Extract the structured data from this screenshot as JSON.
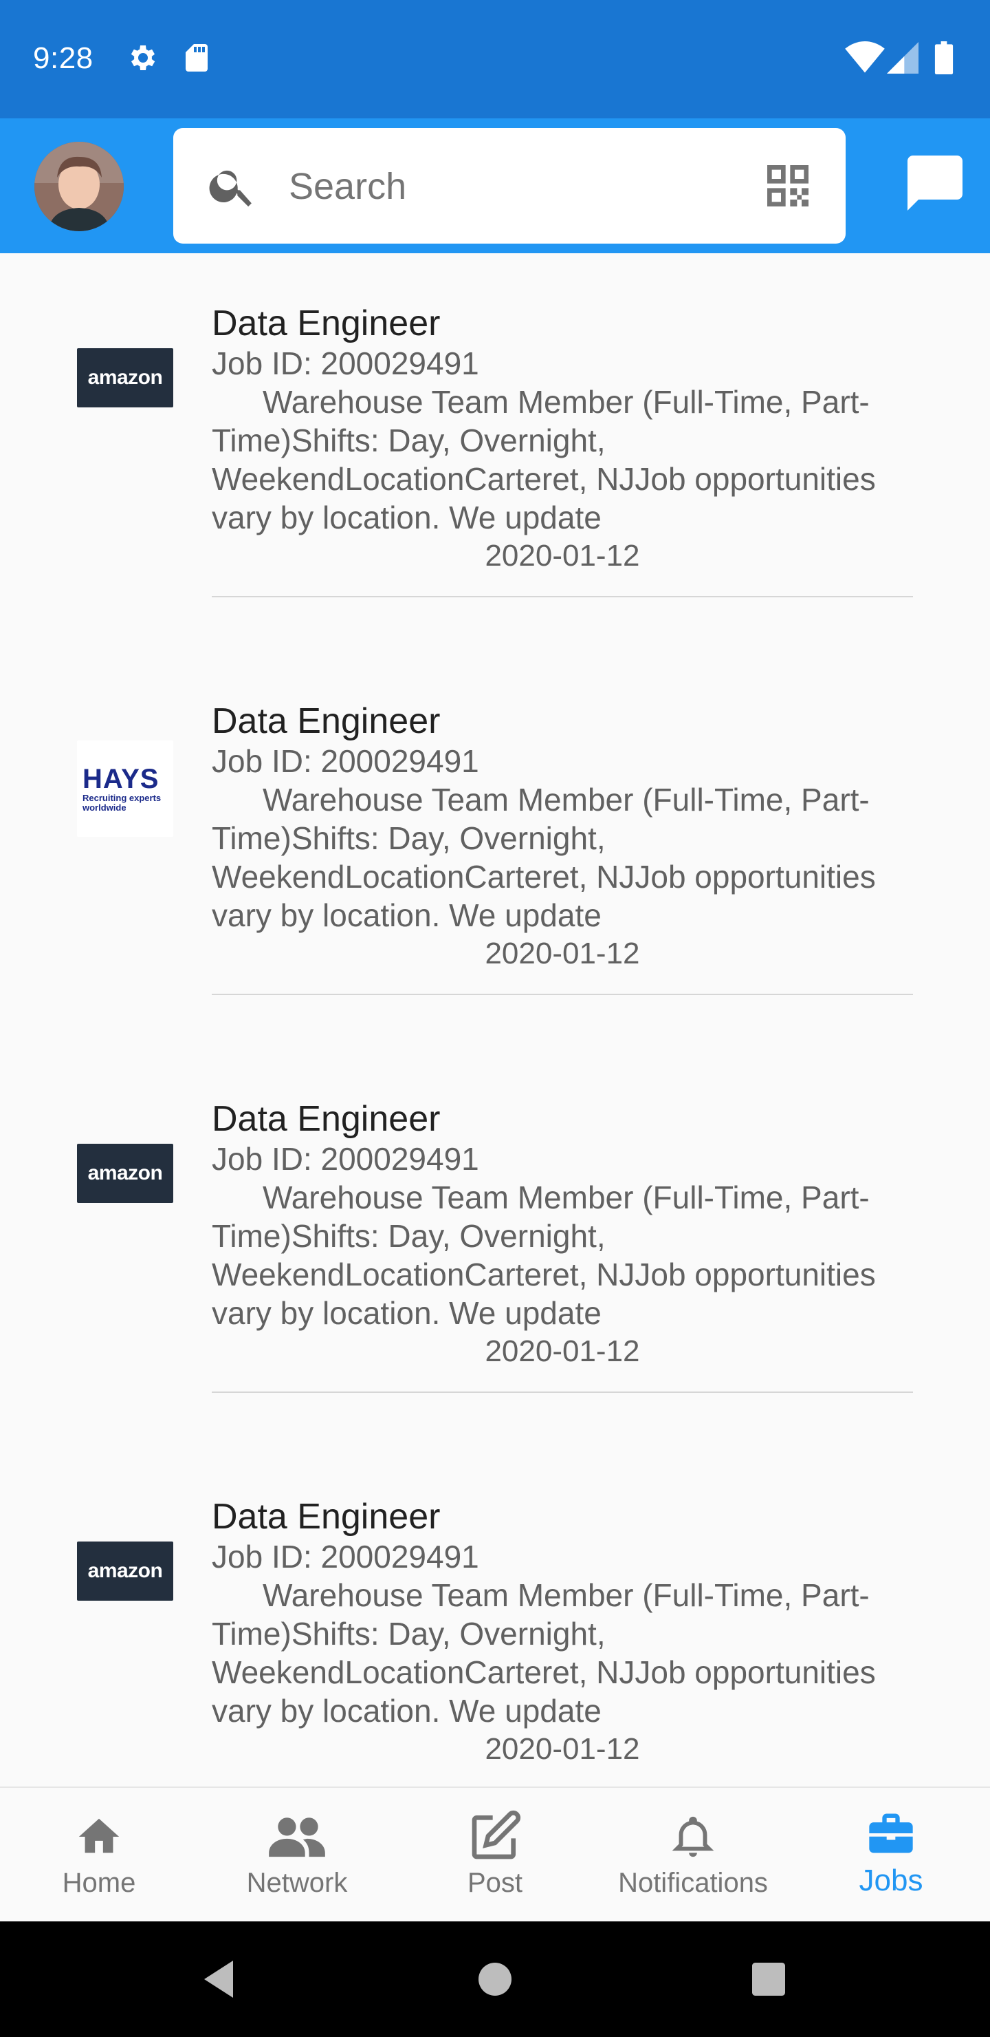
{
  "status_bar": {
    "time": "9:28",
    "icons": [
      "settings-icon",
      "sd-card-icon",
      "wifi-icon",
      "signal-icon",
      "battery-icon"
    ]
  },
  "app_bar": {
    "search": {
      "placeholder": "Search"
    },
    "icons": [
      "avatar",
      "search-icon",
      "qr-code-icon",
      "chat-icon"
    ]
  },
  "jobs": [
    {
      "logo": "amazon",
      "logo_text": "amazon",
      "title": "Data Engineer",
      "job_id": "Job ID: 200029491",
      "description": "Warehouse Team Member (Full-Time, Part-Time)Shifts: Day, Overnight, WeekendLocationCarteret, NJJob opportunities vary by location. We update",
      "date": "2020-01-12"
    },
    {
      "logo": "hays",
      "logo_text": "HAYS",
      "logo_tagline": "Recruiting experts worldwide",
      "title": "Data Engineer",
      "job_id": "Job ID: 200029491",
      "description": "Warehouse Team Member (Full-Time, Part-Time)Shifts: Day, Overnight, WeekendLocationCarteret, NJJob opportunities vary by location. We update",
      "date": "2020-01-12"
    },
    {
      "logo": "amazon",
      "logo_text": "amazon",
      "title": "Data Engineer",
      "job_id": "Job ID: 200029491",
      "description": "Warehouse Team Member (Full-Time, Part-Time)Shifts: Day, Overnight, WeekendLocationCarteret, NJJob opportunities vary by location. We update",
      "date": "2020-01-12"
    },
    {
      "logo": "amazon",
      "logo_text": "amazon",
      "title": "Data Engineer",
      "job_id": "Job ID: 200029491",
      "description": "Warehouse Team Member (Full-Time, Part-Time)Shifts: Day, Overnight, WeekendLocationCarteret, NJJob opportunities vary by location. We update",
      "date": "2020-01-12"
    }
  ],
  "bottom_nav": {
    "items": [
      {
        "label": "Home",
        "icon": "home-icon",
        "active": false
      },
      {
        "label": "Network",
        "icon": "people-icon",
        "active": false
      },
      {
        "label": "Post",
        "icon": "edit-icon",
        "active": false
      },
      {
        "label": "Notifications",
        "icon": "bell-icon",
        "active": false
      },
      {
        "label": "Jobs",
        "icon": "briefcase-icon",
        "active": true
      }
    ]
  },
  "colors": {
    "status_bar": "#1976d2",
    "app_bar": "#2196f3",
    "active_tab": "#2196f3",
    "inactive_tab": "#757575",
    "amazon_logo_bg": "#232f3e",
    "hays_logo_text": "#1b2a8a"
  }
}
